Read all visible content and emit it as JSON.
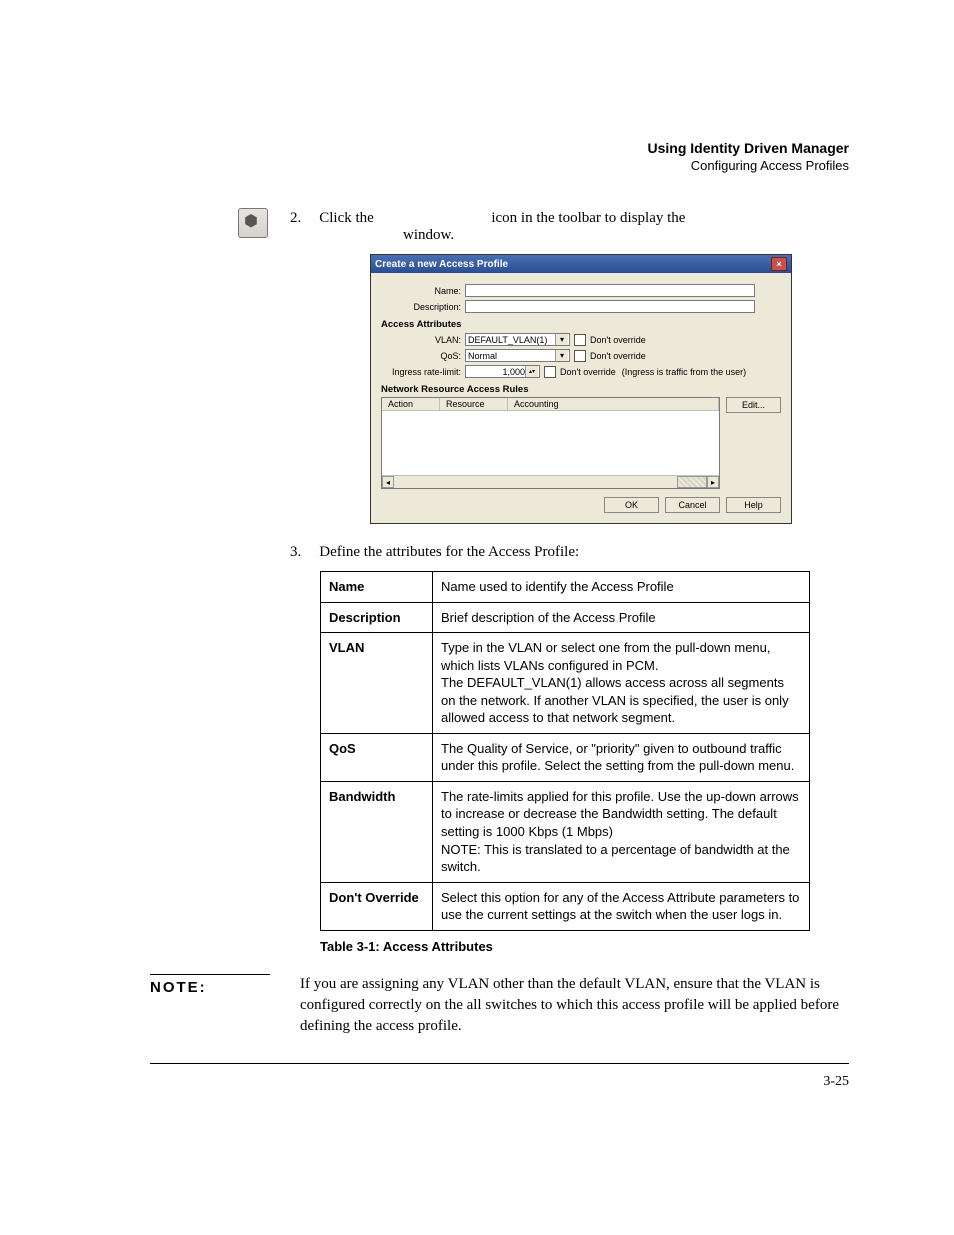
{
  "header": {
    "title": "Using Identity Driven Manager",
    "subtitle": "Configuring Access Profiles"
  },
  "step2": {
    "num": "2.",
    "text_a": "Click the ",
    "text_b": " icon in the toolbar to display the ",
    "text_c": "window."
  },
  "dialog": {
    "title": "Create a new Access Profile",
    "name_label": "Name:",
    "desc_label": "Description:",
    "section_attrs": "Access Attributes",
    "vlan_label": "VLAN:",
    "vlan_value": "DEFAULT_VLAN(1)",
    "vlan_override": "Don't override",
    "qos_label": "QoS:",
    "qos_value": "Normal",
    "qos_override": "Don't override",
    "rate_label": "Ingress rate-limit:",
    "rate_value": "1,000",
    "rate_override": "Don't override",
    "rate_hint": "(Ingress is traffic from the user)",
    "section_rules": "Network Resource Access Rules",
    "col_action": "Action",
    "col_resource": "Resource",
    "col_accounting": "Accounting",
    "edit_btn": "Edit...",
    "ok": "OK",
    "cancel": "Cancel",
    "help": "Help"
  },
  "step3": {
    "num": "3.",
    "text": "Define the attributes for the Access Profile:"
  },
  "table": {
    "rows": [
      {
        "k": "Name",
        "v": "Name used to identify the Access Profile"
      },
      {
        "k": "Description",
        "v": "Brief description of the Access Profile"
      },
      {
        "k": "VLAN",
        "v": "Type in the VLAN or select one from the pull-down menu, which lists VLANs configured in PCM.\nThe DEFAULT_VLAN(1) allows access across all segments on the network. If another VLAN is specified, the user is only allowed access to that network segment."
      },
      {
        "k": "QoS",
        "v": "The Quality of Service, or \"priority\" given to outbound traffic under this profile. Select the setting from the pull-down menu."
      },
      {
        "k": "Bandwidth",
        "v": "The rate-limits applied for this profile. Use the up-down arrows to increase or decrease the Bandwidth setting. The default setting is 1000 Kbps (1 Mbps)\nNOTE: This is translated to a percentage of bandwidth at the switch."
      },
      {
        "k": "Don't Override",
        "v": "Select this option for any of the Access Attribute parameters to use the current settings at the switch when the user logs in."
      }
    ],
    "caption": "Table 3-1: Access Attributes"
  },
  "note": {
    "label": "NOTE:",
    "text": "If you are assigning any VLAN other than the default VLAN, ensure that the VLAN is configured correctly on the all switches to which this access profile will be applied before defining the access profile."
  },
  "pagenum": "3-25"
}
